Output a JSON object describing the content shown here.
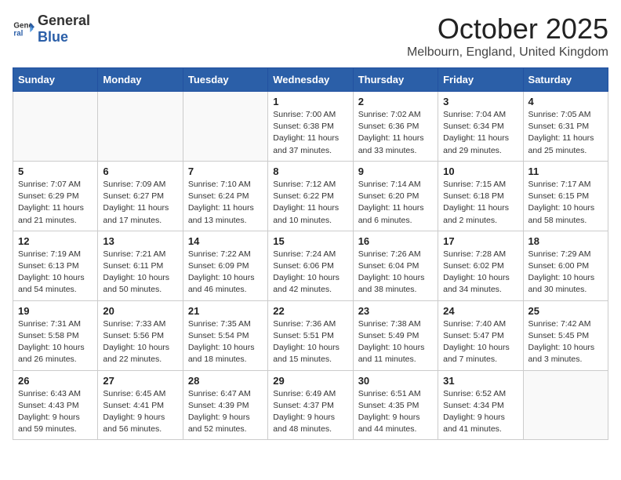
{
  "header": {
    "logo_general": "General",
    "logo_blue": "Blue",
    "month": "October 2025",
    "location": "Melbourn, England, United Kingdom"
  },
  "days_of_week": [
    "Sunday",
    "Monday",
    "Tuesday",
    "Wednesday",
    "Thursday",
    "Friday",
    "Saturday"
  ],
  "weeks": [
    [
      {
        "day": "",
        "info": ""
      },
      {
        "day": "",
        "info": ""
      },
      {
        "day": "",
        "info": ""
      },
      {
        "day": "1",
        "info": "Sunrise: 7:00 AM\nSunset: 6:38 PM\nDaylight: 11 hours\nand 37 minutes."
      },
      {
        "day": "2",
        "info": "Sunrise: 7:02 AM\nSunset: 6:36 PM\nDaylight: 11 hours\nand 33 minutes."
      },
      {
        "day": "3",
        "info": "Sunrise: 7:04 AM\nSunset: 6:34 PM\nDaylight: 11 hours\nand 29 minutes."
      },
      {
        "day": "4",
        "info": "Sunrise: 7:05 AM\nSunset: 6:31 PM\nDaylight: 11 hours\nand 25 minutes."
      }
    ],
    [
      {
        "day": "5",
        "info": "Sunrise: 7:07 AM\nSunset: 6:29 PM\nDaylight: 11 hours\nand 21 minutes."
      },
      {
        "day": "6",
        "info": "Sunrise: 7:09 AM\nSunset: 6:27 PM\nDaylight: 11 hours\nand 17 minutes."
      },
      {
        "day": "7",
        "info": "Sunrise: 7:10 AM\nSunset: 6:24 PM\nDaylight: 11 hours\nand 13 minutes."
      },
      {
        "day": "8",
        "info": "Sunrise: 7:12 AM\nSunset: 6:22 PM\nDaylight: 11 hours\nand 10 minutes."
      },
      {
        "day": "9",
        "info": "Sunrise: 7:14 AM\nSunset: 6:20 PM\nDaylight: 11 hours\nand 6 minutes."
      },
      {
        "day": "10",
        "info": "Sunrise: 7:15 AM\nSunset: 6:18 PM\nDaylight: 11 hours\nand 2 minutes."
      },
      {
        "day": "11",
        "info": "Sunrise: 7:17 AM\nSunset: 6:15 PM\nDaylight: 10 hours\nand 58 minutes."
      }
    ],
    [
      {
        "day": "12",
        "info": "Sunrise: 7:19 AM\nSunset: 6:13 PM\nDaylight: 10 hours\nand 54 minutes."
      },
      {
        "day": "13",
        "info": "Sunrise: 7:21 AM\nSunset: 6:11 PM\nDaylight: 10 hours\nand 50 minutes."
      },
      {
        "day": "14",
        "info": "Sunrise: 7:22 AM\nSunset: 6:09 PM\nDaylight: 10 hours\nand 46 minutes."
      },
      {
        "day": "15",
        "info": "Sunrise: 7:24 AM\nSunset: 6:06 PM\nDaylight: 10 hours\nand 42 minutes."
      },
      {
        "day": "16",
        "info": "Sunrise: 7:26 AM\nSunset: 6:04 PM\nDaylight: 10 hours\nand 38 minutes."
      },
      {
        "day": "17",
        "info": "Sunrise: 7:28 AM\nSunset: 6:02 PM\nDaylight: 10 hours\nand 34 minutes."
      },
      {
        "day": "18",
        "info": "Sunrise: 7:29 AM\nSunset: 6:00 PM\nDaylight: 10 hours\nand 30 minutes."
      }
    ],
    [
      {
        "day": "19",
        "info": "Sunrise: 7:31 AM\nSunset: 5:58 PM\nDaylight: 10 hours\nand 26 minutes."
      },
      {
        "day": "20",
        "info": "Sunrise: 7:33 AM\nSunset: 5:56 PM\nDaylight: 10 hours\nand 22 minutes."
      },
      {
        "day": "21",
        "info": "Sunrise: 7:35 AM\nSunset: 5:54 PM\nDaylight: 10 hours\nand 18 minutes."
      },
      {
        "day": "22",
        "info": "Sunrise: 7:36 AM\nSunset: 5:51 PM\nDaylight: 10 hours\nand 15 minutes."
      },
      {
        "day": "23",
        "info": "Sunrise: 7:38 AM\nSunset: 5:49 PM\nDaylight: 10 hours\nand 11 minutes."
      },
      {
        "day": "24",
        "info": "Sunrise: 7:40 AM\nSunset: 5:47 PM\nDaylight: 10 hours\nand 7 minutes."
      },
      {
        "day": "25",
        "info": "Sunrise: 7:42 AM\nSunset: 5:45 PM\nDaylight: 10 hours\nand 3 minutes."
      }
    ],
    [
      {
        "day": "26",
        "info": "Sunrise: 6:43 AM\nSunset: 4:43 PM\nDaylight: 9 hours\nand 59 minutes."
      },
      {
        "day": "27",
        "info": "Sunrise: 6:45 AM\nSunset: 4:41 PM\nDaylight: 9 hours\nand 56 minutes."
      },
      {
        "day": "28",
        "info": "Sunrise: 6:47 AM\nSunset: 4:39 PM\nDaylight: 9 hours\nand 52 minutes."
      },
      {
        "day": "29",
        "info": "Sunrise: 6:49 AM\nSunset: 4:37 PM\nDaylight: 9 hours\nand 48 minutes."
      },
      {
        "day": "30",
        "info": "Sunrise: 6:51 AM\nSunset: 4:35 PM\nDaylight: 9 hours\nand 44 minutes."
      },
      {
        "day": "31",
        "info": "Sunrise: 6:52 AM\nSunset: 4:34 PM\nDaylight: 9 hours\nand 41 minutes."
      },
      {
        "day": "",
        "info": ""
      }
    ]
  ]
}
